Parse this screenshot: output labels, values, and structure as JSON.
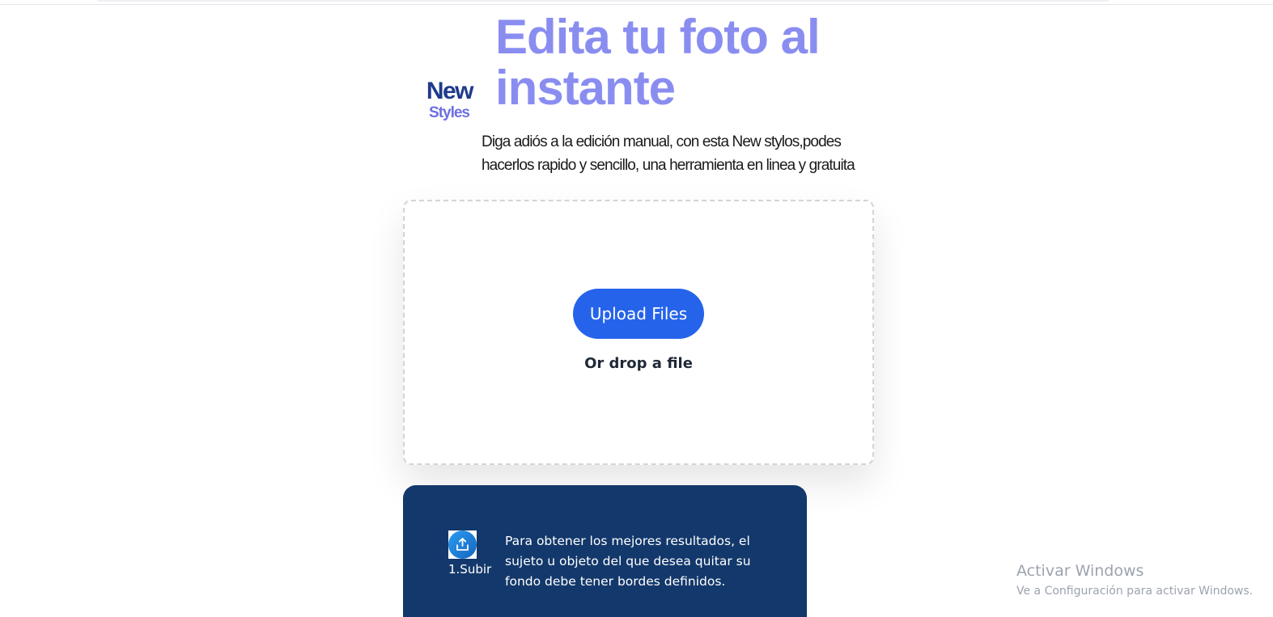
{
  "logo": {
    "line1": "New",
    "line2": "Styles"
  },
  "hero": {
    "title_line1": "Edita tu foto al",
    "title_line2": "instante",
    "subtitle_line1": "Diga adiós a la edición manual, con esta New stylos,podes",
    "subtitle_line2": "hacerlos rapido y sencillo, una herramienta en linea y gratuita"
  },
  "uploader": {
    "button_label": "Upload Files",
    "drop_label": "Or drop a file"
  },
  "steps": {
    "step1_label": "1.Subir",
    "step1_icon": "upload-icon",
    "step1_text_line1": "Para obtener los mejores resultados, el",
    "step1_text_line2": "sujeto u objeto del que desea quitar su",
    "step1_text_line3": "fondo debe tener bordes definidos."
  },
  "watermark": {
    "title": "Activar Windows",
    "subtitle": "Ve a Configuración para activar Windows."
  },
  "colors": {
    "hero_title": "#8a8df0",
    "logo_primary": "#1e3a8a",
    "logo_secondary": "#6d6fe0",
    "button": "#2563eb",
    "info_card": "#13386b"
  }
}
